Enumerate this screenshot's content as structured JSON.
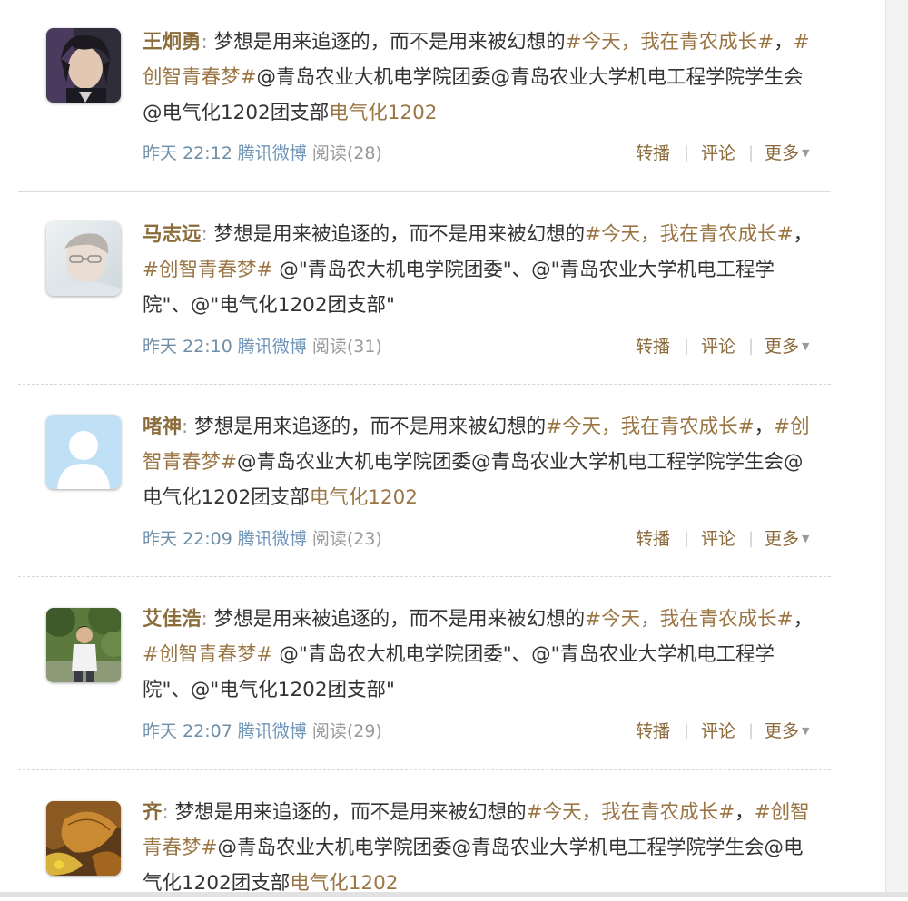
{
  "posts": [
    {
      "author": "王炯勇",
      "colon": ":",
      "segments": [
        {
          "t": "梦想是用来追逐的，而不是用来被幻想的",
          "tag": false
        },
        {
          "t": "#今天，我在青农成长#",
          "tag": true
        },
        {
          "t": "，",
          "tag": false
        },
        {
          "t": "#创智青春梦#",
          "tag": true
        },
        {
          "t": "@青岛农业大机电学院团委@青岛农业大学机电工程学院学生会@电气化1202团支部",
          "tag": false
        },
        {
          "t": "电气化1202",
          "tag": true
        }
      ],
      "time": "昨天 22:12",
      "source": "腾讯微博",
      "reads": "阅读(28)",
      "avatar": "portrait-dark-hair"
    },
    {
      "author": "马志远",
      "colon": ":",
      "segments": [
        {
          "t": "梦想是用来被追逐的，而不是用来被幻想的",
          "tag": false
        },
        {
          "t": "#今天，我在青农成长#",
          "tag": true
        },
        {
          "t": "，",
          "tag": false
        },
        {
          "t": "#创智青春梦#",
          "tag": true
        },
        {
          "t": " @\"青岛农大机电学院团委\"、@\"青岛农业大学机电工程学院\"、@\"电气化1202团支部\"",
          "tag": false
        }
      ],
      "time": "昨天 22:10",
      "source": "腾讯微博",
      "reads": "阅读(31)",
      "avatar": "portrait-light-glasses"
    },
    {
      "author": "啫神",
      "colon": ":",
      "segments": [
        {
          "t": "梦想是用来追逐的，而不是用来被幻想的",
          "tag": false
        },
        {
          "t": "#今天，我在青农成长#",
          "tag": true
        },
        {
          "t": "，",
          "tag": false
        },
        {
          "t": "#创智青春梦#",
          "tag": true
        },
        {
          "t": "@青岛农业大机电学院团委@青岛农业大学机电工程学院学生会@电气化1202团支部",
          "tag": false
        },
        {
          "t": "电气化1202",
          "tag": true
        }
      ],
      "time": "昨天 22:09",
      "source": "腾讯微博",
      "reads": "阅读(23)",
      "avatar": "default-user"
    },
    {
      "author": "艾佳浩",
      "colon": ":",
      "segments": [
        {
          "t": "梦想是用来被追逐的，而不是用来被幻想的",
          "tag": false
        },
        {
          "t": "#今天，我在青农成长#",
          "tag": true
        },
        {
          "t": "，",
          "tag": false
        },
        {
          "t": "#创智青春梦#",
          "tag": true
        },
        {
          "t": " @\"青岛农大机电学院团委\"、@\"青岛农业大学机电工程学院\"、@\"电气化1202团支部\"",
          "tag": false
        }
      ],
      "time": "昨天 22:07",
      "source": "腾讯微博",
      "reads": "阅读(29)",
      "avatar": "outdoor-photo"
    },
    {
      "author": "齐",
      "colon": ":",
      "segments": [
        {
          "t": "梦想是用来追逐的，而不是用来被幻想的",
          "tag": false
        },
        {
          "t": "#今天，我在青农成长#",
          "tag": true
        },
        {
          "t": "，",
          "tag": false
        },
        {
          "t": "#创智青春梦#",
          "tag": true
        },
        {
          "t": "@青岛农业大机电学院团委@青岛农业大学机电工程学院学生会@电气化1202团支部",
          "tag": false
        },
        {
          "t": "电气化1202",
          "tag": true
        }
      ],
      "time": "",
      "source": "",
      "reads": "",
      "avatar": "autumn-leaves"
    }
  ],
  "actions": {
    "repost": "转播",
    "comment": "评论",
    "more": "更多",
    "separator": "|",
    "more_caret": "▼"
  },
  "colors": {
    "author": "#8a6d3b",
    "tag": "#9b7645",
    "body": "#333333",
    "time": "#6f8fa8",
    "action": "#8b6a3c"
  }
}
